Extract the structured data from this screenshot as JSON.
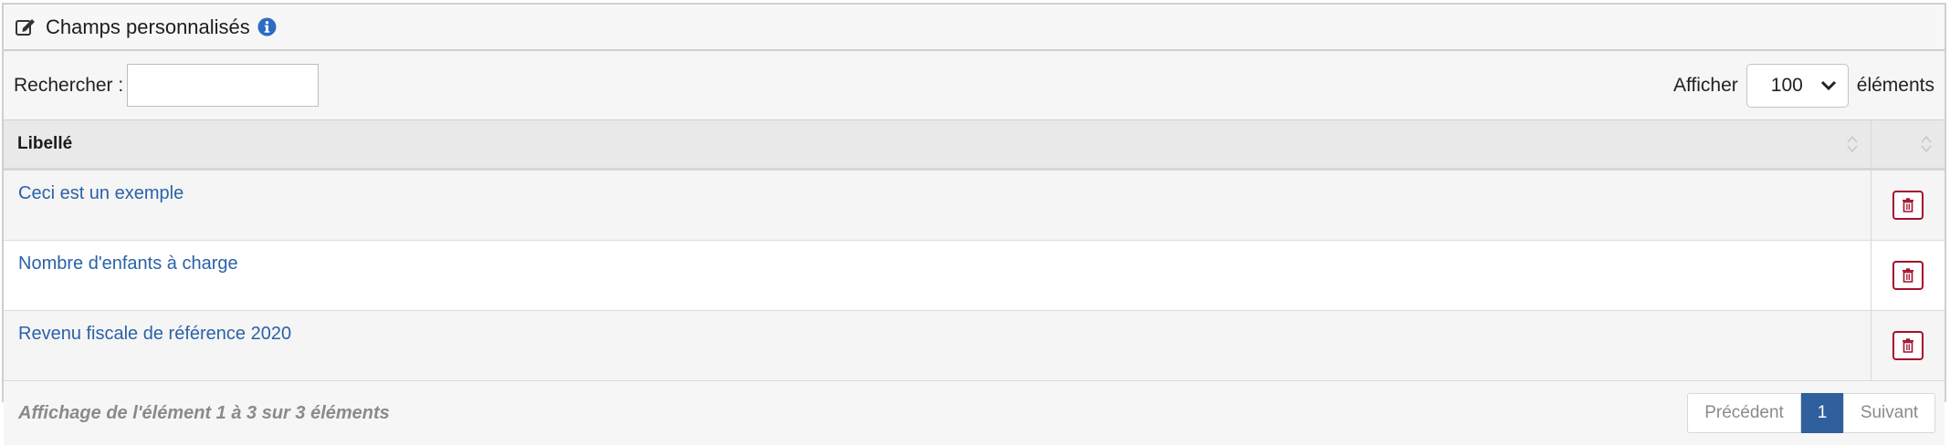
{
  "panel": {
    "title": "Champs personnalisés"
  },
  "toolbar": {
    "search_label": "Rechercher :",
    "search_value": "",
    "length_prefix": "Afficher",
    "length_value": "100",
    "length_suffix": "éléments"
  },
  "table": {
    "columns": [
      "Libellé",
      ""
    ],
    "rows": [
      {
        "label": "Ceci est un exemple"
      },
      {
        "label": "Nombre d'enfants à charge"
      },
      {
        "label": "Revenu fiscale de référence 2020"
      }
    ]
  },
  "footer": {
    "info": "Affichage de l'élément 1 à 3 sur 3 éléments",
    "prev": "Précédent",
    "page": "1",
    "next": "Suivant"
  },
  "colors": {
    "link": "#2a62a8",
    "delete": "#a3102c",
    "active_page": "#305f9e",
    "info_icon": "#2b6cc4"
  },
  "icons": {
    "header": "edit-icon",
    "info": "info-icon",
    "delete": "trash-icon",
    "sort": "sort-icon",
    "select": "chevron-down-icon"
  }
}
